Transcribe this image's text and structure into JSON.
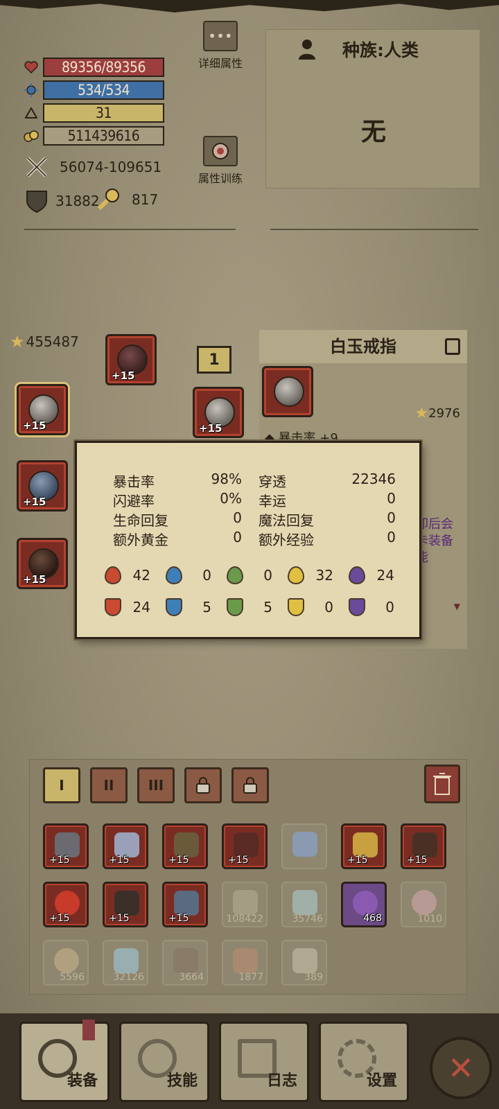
{
  "stats": {
    "hp": "89356/89356",
    "mp": "534/534",
    "level": "31",
    "gold": "511439616",
    "attack": "56074-109651",
    "defense": "31882",
    "key_count": "817"
  },
  "side_buttons": {
    "detail": "详细属性",
    "training": "属性训练"
  },
  "race": {
    "title": "种族:人类",
    "value": "无"
  },
  "equipment": {
    "score": "455487",
    "slot_plus": "+15",
    "tag": "1"
  },
  "item": {
    "name": "白玉戒指",
    "score": "2976",
    "affix": "◆ 暴击率 +9",
    "side_text_1": "卸后会",
    "side_text_2": "卡装备",
    "side_text_3": "能"
  },
  "popup": {
    "rows": [
      {
        "l1": "暴击率",
        "v1": "98%",
        "l2": "穿透",
        "v2": "22346"
      },
      {
        "l1": "闪避率",
        "v1": "0%",
        "l2": "幸运",
        "v2": "0"
      },
      {
        "l1": "生命回复",
        "v1": "0",
        "l2": "魔法回复",
        "v2": "0"
      },
      {
        "l1": "额外黄金",
        "v1": "0",
        "l2": "额外经验",
        "v2": "0"
      }
    ],
    "elements_top": [
      "42",
      "0",
      "0",
      "32",
      "24"
    ],
    "elements_bottom": [
      "24",
      "5",
      "5",
      "0",
      "0"
    ]
  },
  "inventory": {
    "tabs": [
      "I",
      "II",
      "III"
    ],
    "counts": {
      "c108422": "108422",
      "c35746": "35746",
      "c468": "468",
      "c1010": "1010",
      "c5596": "5596",
      "c32126": "32126",
      "c3664": "3664",
      "c1877": "1877",
      "c389": "389"
    }
  },
  "nav": {
    "equip": "装备",
    "skill": "技能",
    "log": "日志",
    "settings": "设置"
  },
  "colors": {
    "hp": "#9c3e3e",
    "mp": "#3f6fa3",
    "level": "#c9b56a",
    "parchment": "#e4d8b3"
  }
}
